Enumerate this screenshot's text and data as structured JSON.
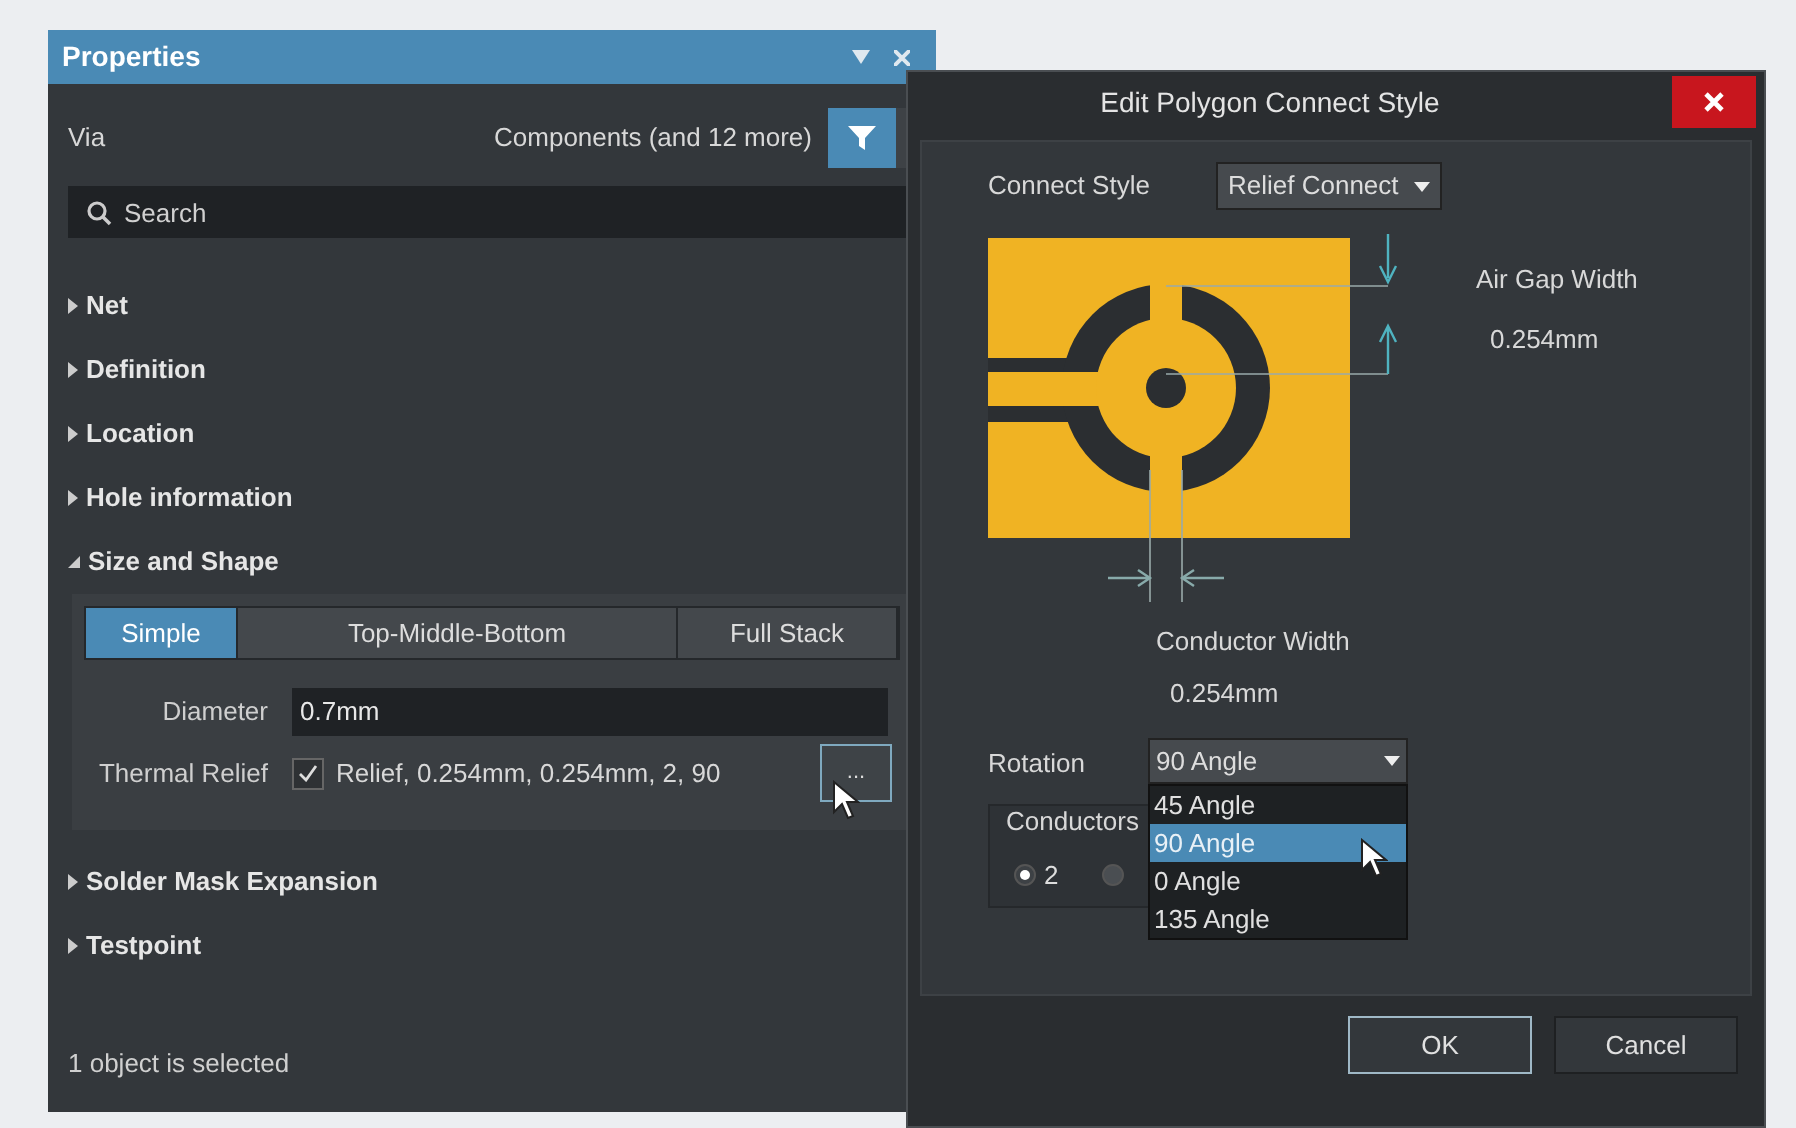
{
  "properties_panel": {
    "title": "Properties",
    "object_type": "Via",
    "filter_label": "Components (and 12 more)",
    "search": {
      "placeholder": "Search"
    },
    "sections": [
      {
        "title": "Net",
        "expanded": false
      },
      {
        "title": "Definition",
        "expanded": false
      },
      {
        "title": "Location",
        "expanded": false
      },
      {
        "title": "Hole information",
        "expanded": false
      },
      {
        "title": "Size and Shape",
        "expanded": true,
        "tabs": [
          {
            "label": "Simple",
            "selected": true
          },
          {
            "label": "Top-Middle-Bottom",
            "selected": false
          },
          {
            "label": "Full Stack",
            "selected": false
          }
        ],
        "diameter": {
          "label": "Diameter",
          "value": "0.7mm"
        },
        "thermal_relief": {
          "label": "Thermal Relief",
          "checked": true,
          "value": "Relief, 0.254mm, 0.254mm, 2, 90",
          "button": "..."
        }
      },
      {
        "title": "Solder Mask Expansion",
        "expanded": false
      },
      {
        "title": "Testpoint",
        "expanded": false
      }
    ],
    "status": "1 object is selected"
  },
  "dialog": {
    "title": "Edit Polygon Connect Style",
    "connect_style": {
      "label": "Connect Style",
      "value": "Relief Connect"
    },
    "air_gap": {
      "label": "Air Gap Width",
      "value": "0.254mm"
    },
    "conductor_width": {
      "label": "Conductor Width",
      "value": "0.254mm"
    },
    "rotation": {
      "label": "Rotation",
      "value": "90 Angle",
      "options": [
        {
          "label": "45 Angle",
          "selected": false
        },
        {
          "label": "90 Angle",
          "selected": true
        },
        {
          "label": "0 Angle",
          "selected": false
        },
        {
          "label": "135 Angle",
          "selected": false
        }
      ]
    },
    "conductors": {
      "label": "Conductors",
      "options": [
        {
          "label": "2",
          "selected": true
        },
        {
          "selected": false
        }
      ]
    },
    "buttons": [
      "OK",
      "Cancel"
    ]
  }
}
